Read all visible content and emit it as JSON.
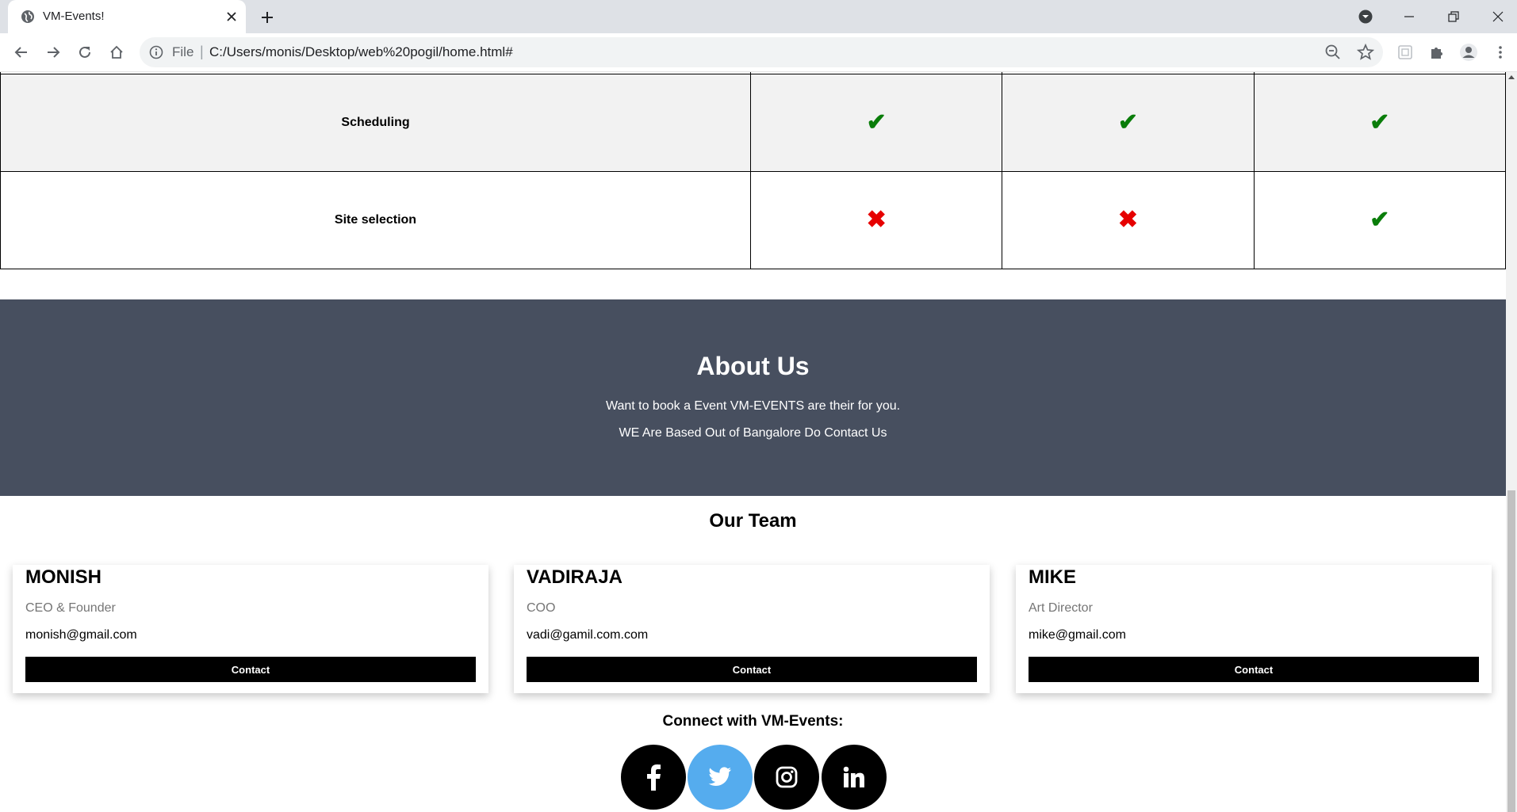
{
  "browser": {
    "tab_title": "VM-Events!",
    "omnibox_scheme": "File",
    "omnibox_separator": "|",
    "url": "C:/Users/monis/Desktop/web%20pogil/home.html#"
  },
  "comparison": {
    "rows": [
      {
        "feature": "Scheduling",
        "marks": [
          "check",
          "check",
          "check"
        ]
      },
      {
        "feature": "Site selection",
        "marks": [
          "cross",
          "cross",
          "check"
        ]
      }
    ],
    "colors": {
      "check": "#0a7d0a",
      "cross": "#e60000"
    }
  },
  "about": {
    "title": "About Us",
    "line1": "Want to book a Event VM-EVENTS are their for you.",
    "line2": "WE Are Based Out of Bangalore Do Contact Us",
    "background": "#474f5f"
  },
  "team": {
    "title": "Our Team",
    "members": [
      {
        "name": "MONISH",
        "role": "CEO & Founder",
        "email": "monish@gmail.com",
        "button": "Contact"
      },
      {
        "name": "VADIRAJA",
        "role": "COO",
        "email": "vadi@gamil.com.com",
        "button": "Contact"
      },
      {
        "name": "MIKE",
        "role": "Art Director",
        "email": "mike@gmail.com",
        "button": "Contact"
      }
    ]
  },
  "connect": {
    "title": "Connect with VM-Events:",
    "icons": [
      "facebook-icon",
      "twitter-icon",
      "instagram-icon",
      "linkedin-icon"
    ],
    "twitter_color": "#55acee"
  }
}
